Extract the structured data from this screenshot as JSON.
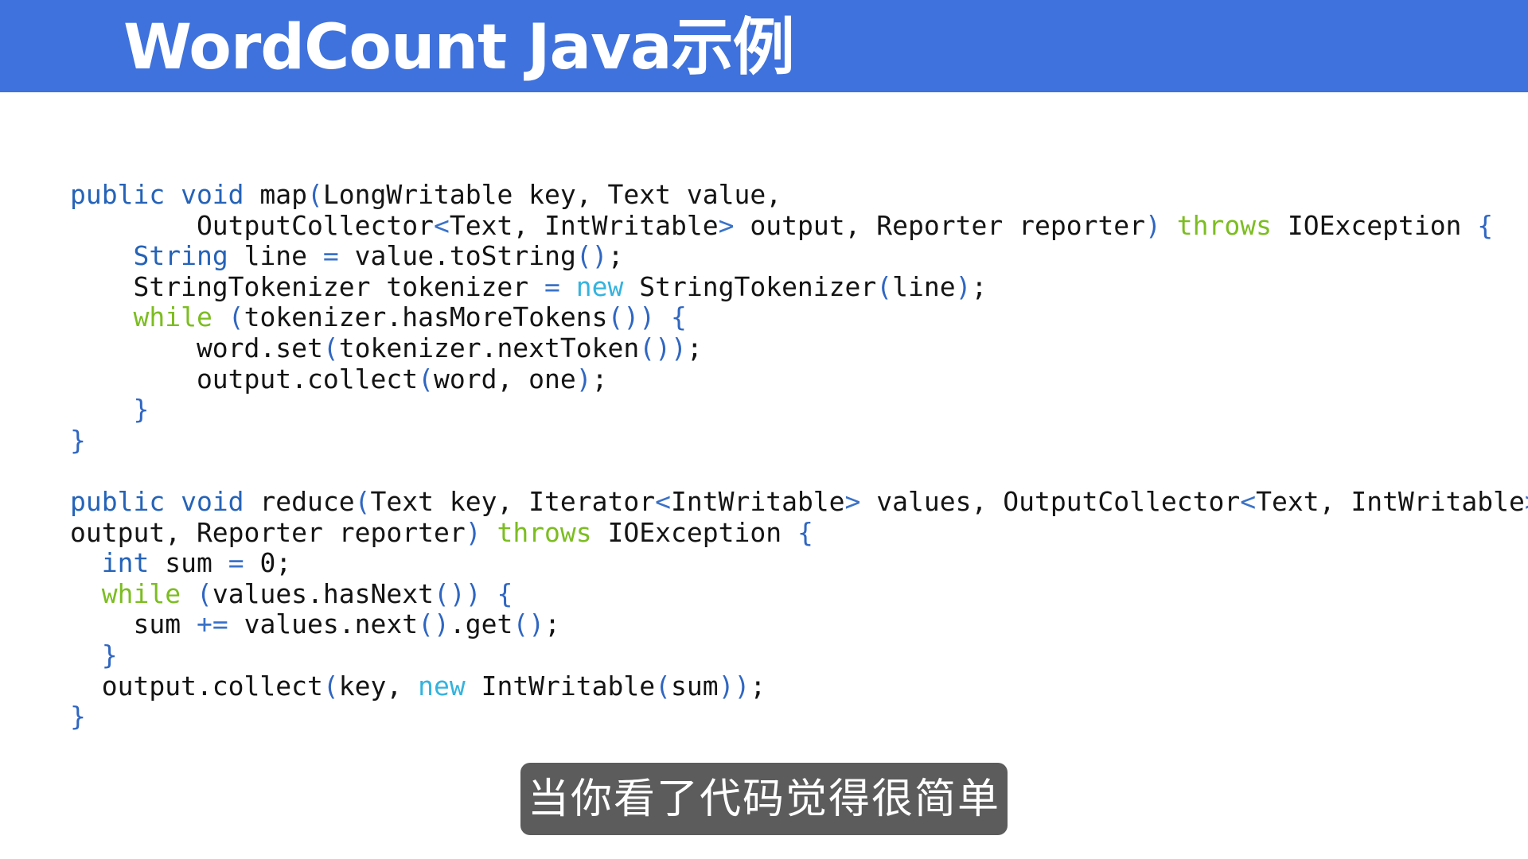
{
  "slide": {
    "title": "WordCount Java示例"
  },
  "code": {
    "lines": [
      [
        {
          "t": "public void",
          "c": "kw"
        },
        {
          "t": " map"
        },
        {
          "t": "(",
          "c": "br"
        },
        {
          "t": "LongWritable key, Text value,"
        }
      ],
      [
        {
          "t": "        OutputCollector"
        },
        {
          "t": "<",
          "c": "op"
        },
        {
          "t": "Text, IntWritable"
        },
        {
          "t": ">",
          "c": "op"
        },
        {
          "t": " output, Reporter reporter"
        },
        {
          "t": ")",
          "c": "br"
        },
        {
          "t": " "
        },
        {
          "t": "throws",
          "c": "flow"
        },
        {
          "t": " IOException "
        },
        {
          "t": "{",
          "c": "br"
        }
      ],
      [
        {
          "t": "    "
        },
        {
          "t": "String",
          "c": "kw"
        },
        {
          "t": " line "
        },
        {
          "t": "=",
          "c": "op"
        },
        {
          "t": " value.toString"
        },
        {
          "t": "()",
          "c": "br"
        },
        {
          "t": ";"
        }
      ],
      [
        {
          "t": "    StringTokenizer tokenizer "
        },
        {
          "t": "=",
          "c": "op"
        },
        {
          "t": " "
        },
        {
          "t": "new",
          "c": "new"
        },
        {
          "t": " StringTokenizer"
        },
        {
          "t": "(",
          "c": "br"
        },
        {
          "t": "line"
        },
        {
          "t": ")",
          "c": "br"
        },
        {
          "t": ";"
        }
      ],
      [
        {
          "t": "    "
        },
        {
          "t": "while",
          "c": "flow"
        },
        {
          "t": " "
        },
        {
          "t": "(",
          "c": "br"
        },
        {
          "t": "tokenizer.hasMoreTokens"
        },
        {
          "t": "())",
          "c": "br"
        },
        {
          "t": " "
        },
        {
          "t": "{",
          "c": "br"
        }
      ],
      [
        {
          "t": "        word.set"
        },
        {
          "t": "(",
          "c": "br"
        },
        {
          "t": "tokenizer.nextToken"
        },
        {
          "t": "())",
          "c": "br"
        },
        {
          "t": ";"
        }
      ],
      [
        {
          "t": "        output.collect"
        },
        {
          "t": "(",
          "c": "br"
        },
        {
          "t": "word, one"
        },
        {
          "t": ")",
          "c": "br"
        },
        {
          "t": ";"
        }
      ],
      [
        {
          "t": "    "
        },
        {
          "t": "}",
          "c": "br"
        }
      ],
      [
        {
          "t": "}",
          "c": "br"
        }
      ],
      [],
      [
        {
          "t": "public void",
          "c": "kw"
        },
        {
          "t": " reduce"
        },
        {
          "t": "(",
          "c": "br"
        },
        {
          "t": "Text key, Iterator"
        },
        {
          "t": "<",
          "c": "op"
        },
        {
          "t": "IntWritable"
        },
        {
          "t": ">",
          "c": "op"
        },
        {
          "t": " values, OutputCollector"
        },
        {
          "t": "<",
          "c": "op"
        },
        {
          "t": "Text, IntWritable"
        },
        {
          "t": ">",
          "c": "op"
        }
      ],
      [
        {
          "t": "output, Reporter reporter"
        },
        {
          "t": ")",
          "c": "br"
        },
        {
          "t": " "
        },
        {
          "t": "throws",
          "c": "flow"
        },
        {
          "t": " IOException "
        },
        {
          "t": "{",
          "c": "br"
        }
      ],
      [
        {
          "t": "  "
        },
        {
          "t": "int",
          "c": "kw"
        },
        {
          "t": " sum "
        },
        {
          "t": "=",
          "c": "op"
        },
        {
          "t": " 0;"
        }
      ],
      [
        {
          "t": "  "
        },
        {
          "t": "while",
          "c": "flow"
        },
        {
          "t": " "
        },
        {
          "t": "(",
          "c": "br"
        },
        {
          "t": "values.hasNext"
        },
        {
          "t": "())",
          "c": "br"
        },
        {
          "t": " "
        },
        {
          "t": "{",
          "c": "br"
        }
      ],
      [
        {
          "t": "    sum "
        },
        {
          "t": "+=",
          "c": "op"
        },
        {
          "t": " values.next"
        },
        {
          "t": "()",
          "c": "br"
        },
        {
          "t": ".get"
        },
        {
          "t": "()",
          "c": "br"
        },
        {
          "t": ";"
        }
      ],
      [
        {
          "t": "  "
        },
        {
          "t": "}",
          "c": "br"
        }
      ],
      [
        {
          "t": "  output.collect"
        },
        {
          "t": "(",
          "c": "br"
        },
        {
          "t": "key, "
        },
        {
          "t": "new",
          "c": "new"
        },
        {
          "t": " IntWritable"
        },
        {
          "t": "(",
          "c": "br"
        },
        {
          "t": "sum"
        },
        {
          "t": "))",
          "c": "br"
        },
        {
          "t": ";"
        }
      ],
      [
        {
          "t": "}",
          "c": "br"
        }
      ]
    ]
  },
  "subtitle": {
    "text": "当你看了代码觉得很简单"
  }
}
